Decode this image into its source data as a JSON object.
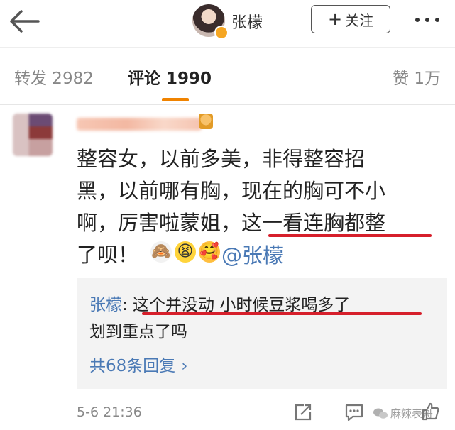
{
  "header": {
    "author_name": "张檬",
    "follow_plus": "+",
    "follow_label": "关注"
  },
  "tabs": {
    "repost": "转发 2982",
    "comments": "评论 1990",
    "likes": "赞 1万"
  },
  "comment": {
    "lines": [
      "整容女，以前多美，非得整容招",
      "黑，以前哪有胸，现在的胸可不小",
      "啊，厉害啦蒙姐，这一看连胸都整",
      "了呗！"
    ],
    "emojis": [
      "🙈",
      "😫",
      "🥰"
    ],
    "mention": "@张檬",
    "time": "5-6 21:36"
  },
  "reply": {
    "name": "张檬",
    "sep": ":",
    "text1": " 这个并没动  小时候豆浆喝多了",
    "text2": "划到重点了吗",
    "count": "共68条回复",
    "chevron": "›"
  },
  "watermark": {
    "text": "麻辣表哥"
  },
  "colors": {
    "accent": "#f08300",
    "link": "#4a79b5",
    "highlight": "#d61f2b"
  }
}
